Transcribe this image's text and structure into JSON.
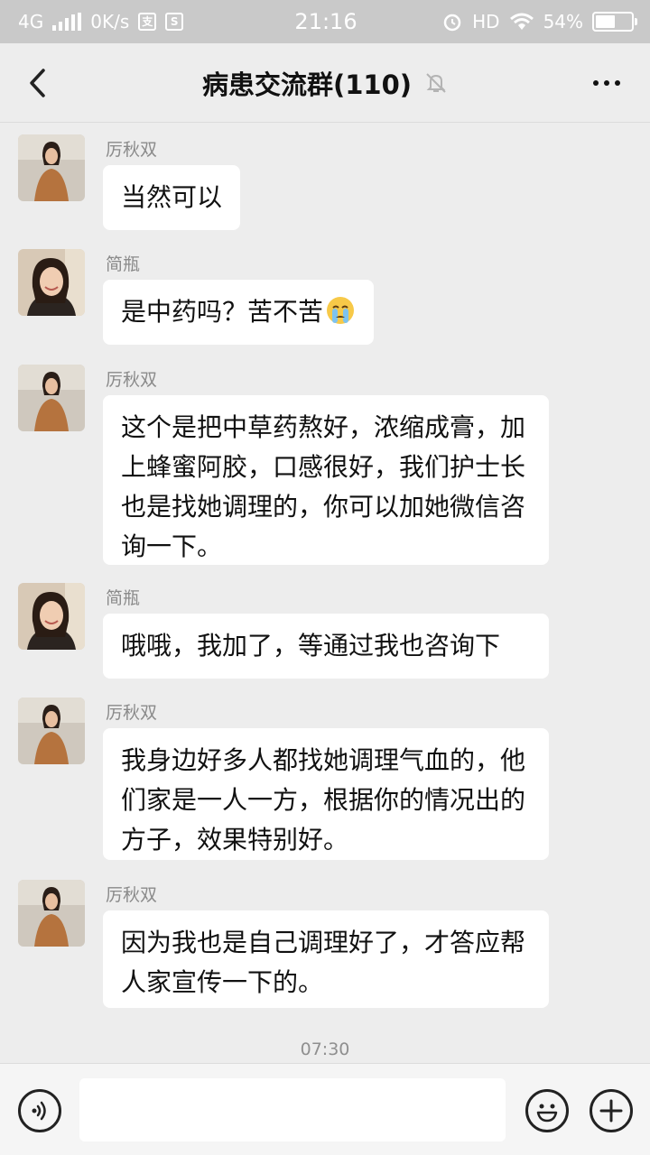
{
  "status_bar": {
    "network": "4G",
    "speed": "0K/s",
    "time": "21:16",
    "hd": "HD",
    "battery": "54%",
    "battery_level": 0.54
  },
  "header": {
    "title": "病患交流群(110)",
    "icons": [
      "back-icon",
      "mute-bell-icon",
      "more-icon"
    ]
  },
  "messages": [
    {
      "sender": "厉秋双",
      "text": "当然可以"
    },
    {
      "sender": "简瓶",
      "text": "是中药吗？苦不苦",
      "emoji": "crying-face"
    },
    {
      "sender": "厉秋双",
      "text": "这个是把中草药熬好，浓缩成膏，加上蜂蜜阿胶，口感很好，我们护士长也是找她调理的，你可以加她微信咨询一下。"
    },
    {
      "sender": "简瓶",
      "text": "哦哦，我加了，等通过我也咨询下"
    },
    {
      "sender": "厉秋双",
      "text": "我身边好多人都找她调理气血的，他们家是一人一方，根据你的情况出的方子，效果特别好。"
    },
    {
      "sender": "厉秋双",
      "text": "因为我也是自己调理好了，才答应帮人家宣传一下的。"
    }
  ],
  "time_divider": "07:30",
  "input_bar": {
    "value": "",
    "icons": [
      "voice-icon",
      "emoji-icon",
      "plus-icon"
    ]
  },
  "colors": {
    "status_bar_bg": "#c9c9c9",
    "page_bg": "#ededed",
    "bubble_bg": "#ffffff",
    "sender_name": "#8a8a8a"
  }
}
